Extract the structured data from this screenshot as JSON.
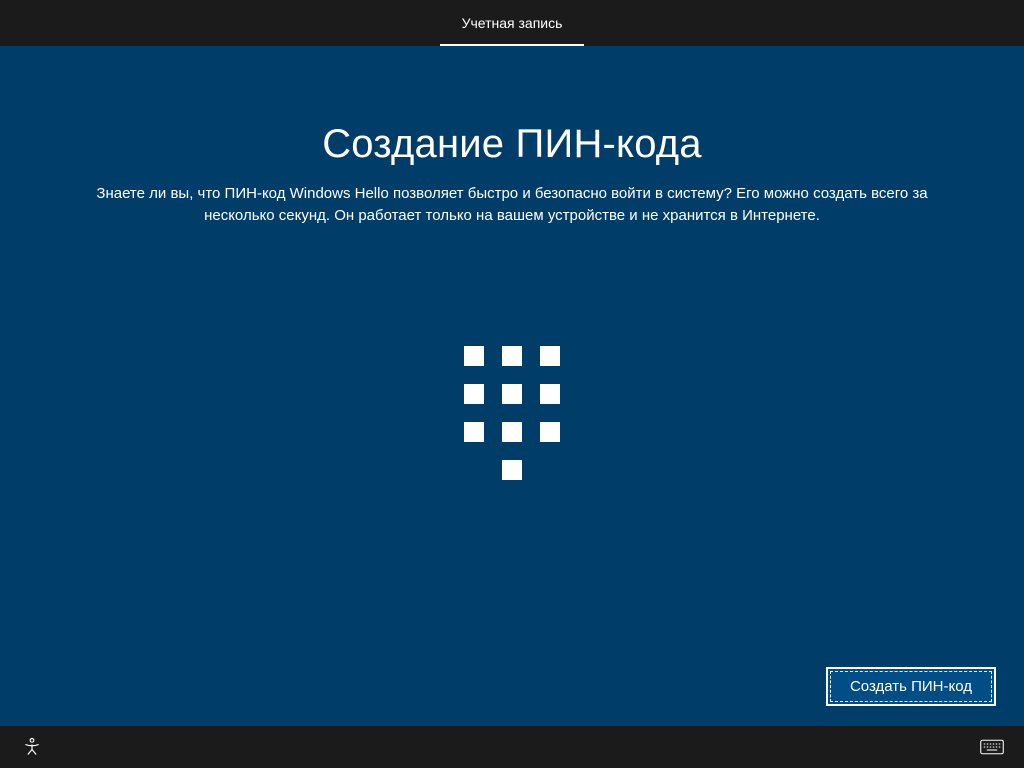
{
  "tabs": {
    "active_label": "Учетная запись"
  },
  "page": {
    "title": "Создание ПИН-кода",
    "subtitle": "Знаете ли вы, что ПИН-код Windows Hello позволяет быстро и безопасно войти в систему? Его можно создать всего за несколько секунд. Он работает только на вашем устройстве и не хранится в Интернете."
  },
  "actions": {
    "create_pin": "Создать ПИН-код"
  },
  "icons": {
    "ease_of_access": "ease-of-access-icon",
    "on_screen_keyboard": "keyboard-icon"
  },
  "colors": {
    "background": "#003e69",
    "bar": "#1b1b1b",
    "button": "#004e85"
  }
}
